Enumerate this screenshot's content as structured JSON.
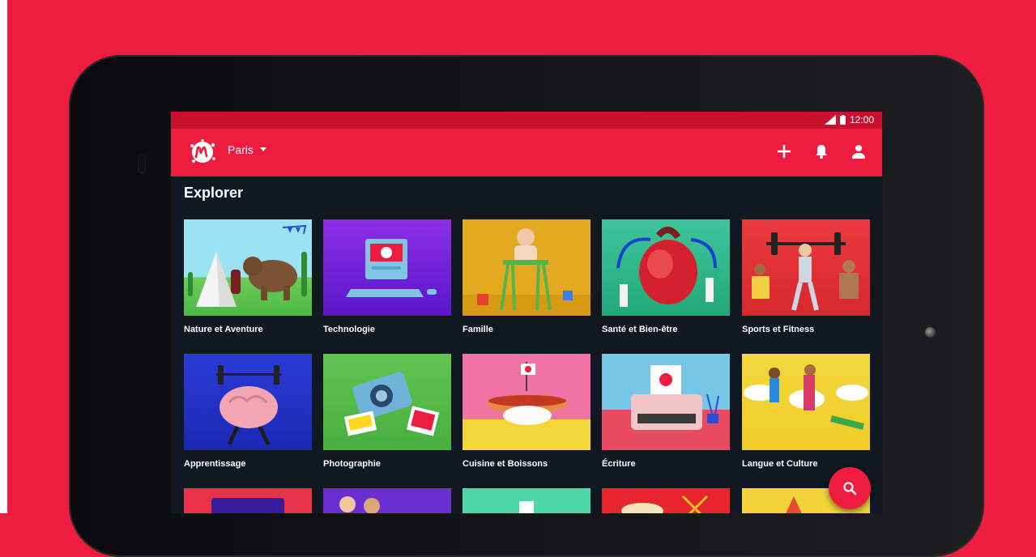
{
  "status": {
    "time": "12:00"
  },
  "appbar": {
    "city": "Paris"
  },
  "section_title": "Explorer",
  "categories": [
    {
      "label": "Nature et Aventure",
      "bg": "#62c25b"
    },
    {
      "label": "Technologie",
      "bg": "#6a1fd6"
    },
    {
      "label": "Famille",
      "bg": "#e0a21c"
    },
    {
      "label": "Santé et Bien-être",
      "bg": "#32b88d"
    },
    {
      "label": "Sports et Fitness",
      "bg": "#e63238"
    },
    {
      "label": "Apprentissage",
      "bg": "#2231c7"
    },
    {
      "label": "Photographie",
      "bg": "#5bc150"
    },
    {
      "label": "Cuisine et Boissons",
      "bg": "#ef6fa0"
    },
    {
      "label": "Écriture",
      "bg": "#e64a5e"
    },
    {
      "label": "Langue et Culture",
      "bg": "#f2d23a"
    }
  ],
  "icons": {
    "logo": "meetup-logo-icon",
    "add": "plus-icon",
    "notifications": "bell-icon",
    "profile": "user-icon",
    "search": "search-icon"
  }
}
